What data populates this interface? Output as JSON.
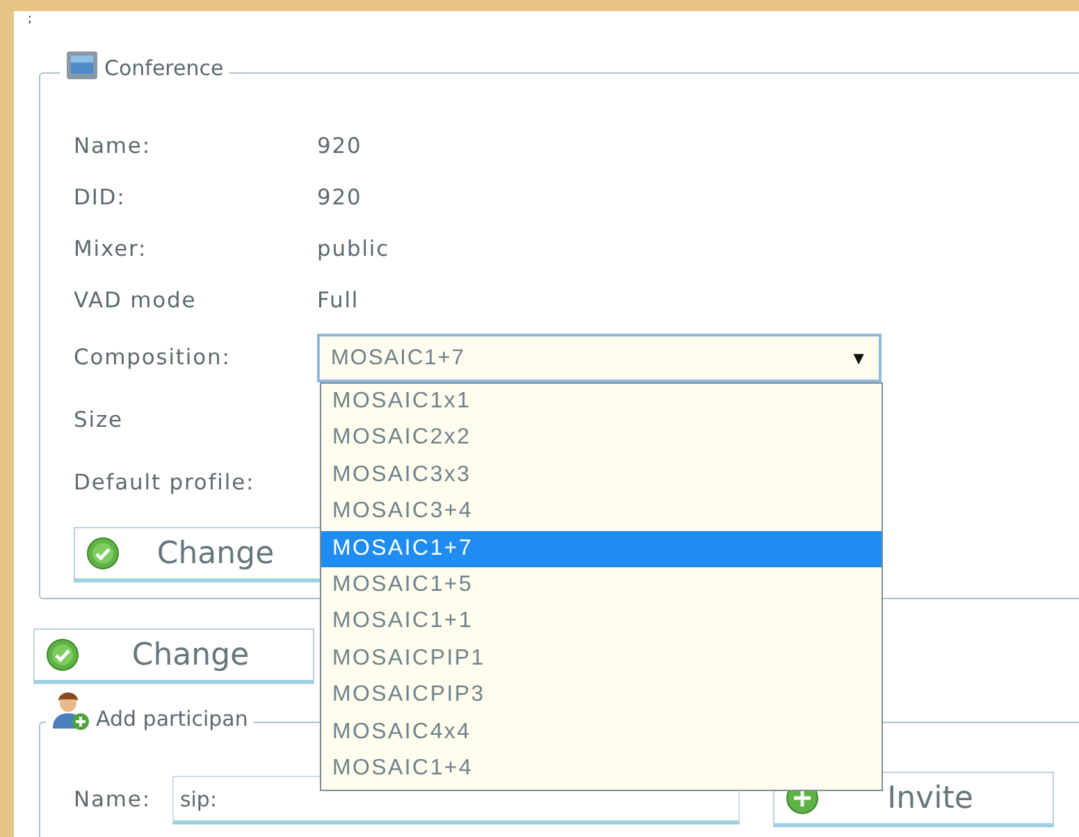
{
  "top_mark": ";",
  "conference": {
    "legend": "Conference",
    "fields": [
      {
        "label": "Name:",
        "value": "920"
      },
      {
        "label": "DID:",
        "value": "920"
      },
      {
        "label": "Mixer:",
        "value": "public"
      },
      {
        "label": "VAD mode",
        "value": "Full"
      },
      {
        "label": "Composition:",
        "kind": "select",
        "value": "MOSAIC1+7",
        "arrow": "▼"
      },
      {
        "label": "Size"
      },
      {
        "label": "Default profile:"
      }
    ],
    "button": "Change"
  },
  "composition_options": [
    {
      "label": "MOSAIC1x1",
      "selected": false
    },
    {
      "label": "MOSAIC2x2",
      "selected": false
    },
    {
      "label": "MOSAIC3x3",
      "selected": false
    },
    {
      "label": "MOSAIC3+4",
      "selected": false
    },
    {
      "label": "MOSAIC1+7",
      "selected": true
    },
    {
      "label": "MOSAIC1+5",
      "selected": false
    },
    {
      "label": "MOSAIC1+1",
      "selected": false
    },
    {
      "label": "MOSAICPIP1",
      "selected": false
    },
    {
      "label": "MOSAICPIP3",
      "selected": false
    },
    {
      "label": "MOSAIC4x4",
      "selected": false
    },
    {
      "label": "MOSAIC1+4",
      "selected": false
    }
  ],
  "change_button": "Change",
  "add_participant": {
    "legend": "Add participan",
    "name_label": "Name:",
    "name_value": "sip:",
    "button": "Invite"
  }
}
